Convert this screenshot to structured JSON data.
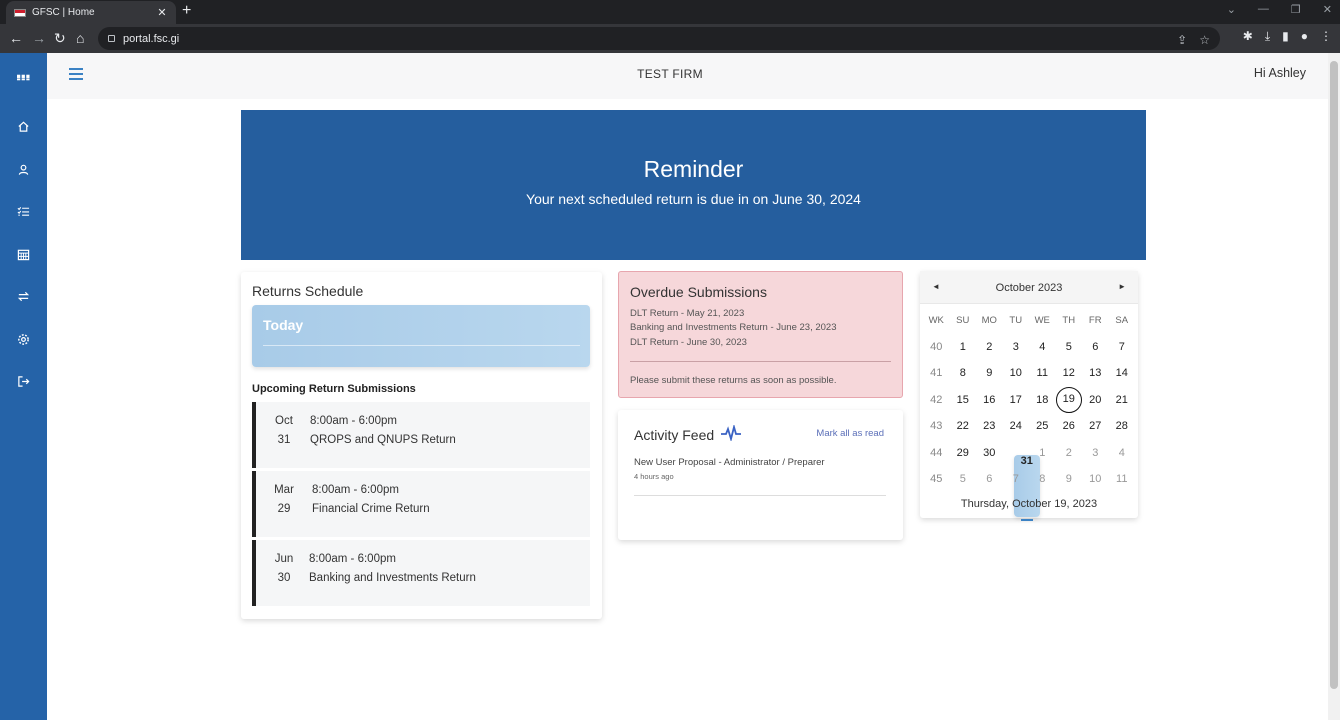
{
  "browser": {
    "tab_title": "GFSC | Home",
    "tab_close": "✕",
    "new_tab": "+",
    "url": "portal.fsc.gi"
  },
  "header": {
    "firm_name": "TEST FIRM",
    "greeting": "Hi Ashley"
  },
  "sidebar": {
    "items": [
      "apps",
      "home",
      "user",
      "list",
      "calendar",
      "transfer",
      "settings",
      "logout"
    ]
  },
  "banner": {
    "title": "Reminder",
    "message": "Your next scheduled return is due in on June 30, 2024"
  },
  "schedule": {
    "title": "Returns Schedule",
    "today_label": "Today",
    "upcoming_title": "Upcoming Return Submissions",
    "events": [
      {
        "month": "Oct",
        "day": "31",
        "time": "8:00am - 6:00pm",
        "name": "QROPS and QNUPS Return"
      },
      {
        "month": "Mar",
        "day": "29",
        "time": "8:00am - 6:00pm",
        "name": "Financial Crime Return"
      },
      {
        "month": "Jun",
        "day": "30",
        "time": "8:00am - 6:00pm",
        "name": "Banking and Investments Return"
      }
    ]
  },
  "overdue": {
    "title": "Overdue Submissions",
    "items": [
      "DLT Return - May 21, 2023",
      "Banking and Investments Return - June 23, 2023",
      "DLT Return - June 30, 2023"
    ],
    "note": "Please submit these returns as soon as possible."
  },
  "activity": {
    "title": "Activity Feed",
    "mark_all": "Mark all as read",
    "item": "New User Proposal - Administrator / Preparer",
    "time_ago": "4 hours ago"
  },
  "calendar": {
    "month_label": "October 2023",
    "prev": "◄",
    "next": "►",
    "headers": [
      "WK",
      "SU",
      "MO",
      "TU",
      "WE",
      "TH",
      "FR",
      "SA"
    ],
    "weeks": [
      {
        "wk": "40",
        "days": [
          "1",
          "2",
          "3",
          "4",
          "5",
          "6",
          "7"
        ]
      },
      {
        "wk": "41",
        "days": [
          "8",
          "9",
          "10",
          "11",
          "12",
          "13",
          "14"
        ]
      },
      {
        "wk": "42",
        "days": [
          "15",
          "16",
          "17",
          "18",
          "19",
          "20",
          "21"
        ]
      },
      {
        "wk": "43",
        "days": [
          "22",
          "23",
          "24",
          "25",
          "26",
          "27",
          "28"
        ]
      },
      {
        "wk": "44",
        "days": [
          "29",
          "30",
          "31",
          "1",
          "2",
          "3",
          "4"
        ]
      },
      {
        "wk": "45",
        "days": [
          "5",
          "6",
          "7",
          "8",
          "9",
          "10",
          "11"
        ]
      }
    ],
    "selected_day": "19",
    "today_day": "31",
    "footer": "Thursday, October 19, 2023"
  }
}
